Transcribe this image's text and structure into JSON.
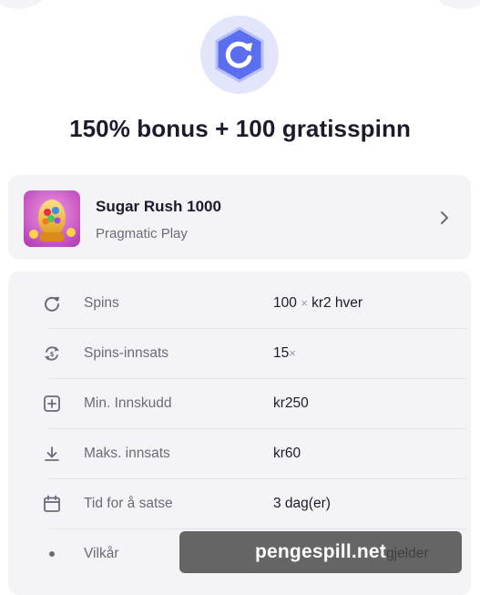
{
  "offer": {
    "title": "150% bonus + 100 gratisspinn"
  },
  "game": {
    "name": "Sugar Rush 1000",
    "provider": "Pragmatic Play"
  },
  "details": [
    {
      "icon": "refresh-icon",
      "label": "Spins",
      "value_main": "100",
      "value_sep": "×",
      "value_rest": "kr2 hver"
    },
    {
      "icon": "wager-cycle-icon",
      "label": "Spins-innsats",
      "value_main": "15",
      "value_sep": "×",
      "value_rest": ""
    },
    {
      "icon": "plus-square-icon",
      "label": "Min. Innskudd",
      "value_main": "kr250",
      "value_sep": "",
      "value_rest": ""
    },
    {
      "icon": "download-arrow-icon",
      "label": "Maks. innsats",
      "value_main": "kr60",
      "value_sep": "",
      "value_rest": ""
    },
    {
      "icon": "calendar-icon",
      "label": "Tid for å satse",
      "value_main": "3 dag(er)",
      "value_sep": "",
      "value_rest": ""
    },
    {
      "icon": "dot-icon",
      "label": "Vilkår",
      "value_main": "",
      "value_sep": "",
      "value_rest": "",
      "link": "gjelder"
    }
  ],
  "watermark": {
    "text": "pengespill.net"
  },
  "colors": {
    "brand": "#5b6ef0",
    "link": "#6b5be0",
    "card_bg": "#f4f4f7"
  }
}
